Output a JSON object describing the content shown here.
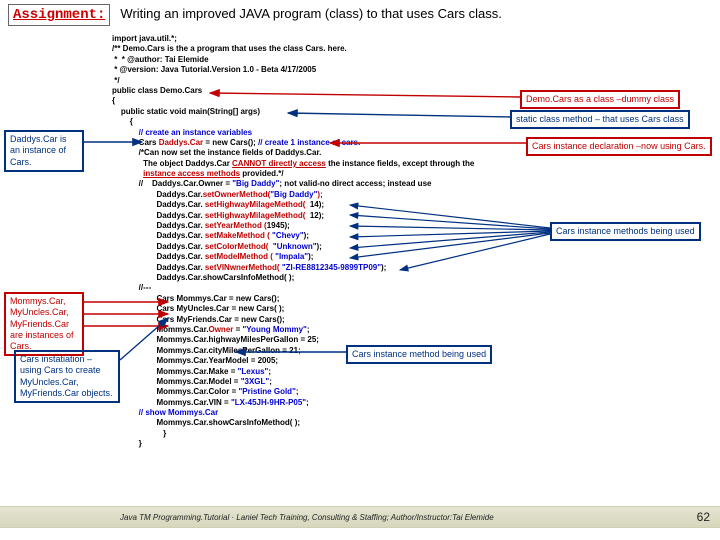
{
  "header": {
    "assignment_label": "Assignment:",
    "assignment_text": "Writing an improved JAVA program (class) to that uses Cars class."
  },
  "code": {
    "l1": "import java.util.*;",
    "l2": "/** Demo.Cars is the a program that uses the class Cars. here.",
    "l3": " *  * @author: Tai Elemide",
    "l4": " * @version: Java Tutorial.Version 1.0 - Beta 4/17/2005",
    "l5": " */",
    "l6": "public class Demo.Cars",
    "l7": "{",
    "l8": "    public static void main(String[] args)",
    "l9": "        {",
    "l10a": "            ",
    "l10b": "// create an instance variables",
    "l11a": "            Cars ",
    "l11b": "Daddys.Car",
    "l11c": " = new Cars(); ",
    "l11d": "// create 1 instance of cars.",
    "blank1": "",
    "c1a": "            /*Can now set the instance fields of Daddys.Car.",
    "c1b": "              The object Daddys.Car ",
    "c1c": "CANNOT directly access",
    "c1d": " the instance fields, except through the",
    "c2a": "              ",
    "c2b": "instance access methods",
    "c2c": " provided.*/",
    "c3a": "            //    Daddys.Car.Owner = ",
    "c3b": "\"Big Daddy\"",
    "c3c": "; not valid-no direct access; instead use",
    "m1a": "                    Daddys.Car.",
    "m1b": "setOwnerMethod(",
    "m1c": "\"Big Daddy\"",
    "m1d": ");",
    "m2a": "                    Daddys.Car. ",
    "m2b": "setHighwayMilageMethod(",
    "m2c": "  14);",
    "m3a": "                    Daddys.Car. ",
    "m3b": "setHighwayMilageMethod(",
    "m3c": "  12);",
    "m4a": "                    Daddys.Car. ",
    "m4b": "setYearMethod (",
    "m4c": "1945);",
    "m5a": "                    Daddys.Car. ",
    "m5b": "setMakeMethod (",
    "m5c": " \"Chevy\"",
    "m5d": ");",
    "m6a": "                    Daddys.Car. ",
    "m6b": "setColorMethod(",
    "m6c": "  \"Unknown\"",
    "m6d": ");",
    "m7a": "                    Daddys.Car. ",
    "m7b": "setModelMethod (",
    "m7c": " \"Impala\"",
    "m7d": ");",
    "m8a": "                    Daddys.Car. ",
    "m8b": "setVINwnerMethod(",
    "m8c": " \"ZI-RE8812345-9899TP09\"",
    "m8d": ");",
    "m9": "                    Daddys.Car.showCarsInfoMethod( );",
    "dash": "            //---",
    "i1": "                    Cars Mommys.Car = new Cars();",
    "i2": "                    Cars MyUncles.Car = new Cars( );",
    "i3": "                    Cars MyFriends.Car = new Cars();",
    "blank2": "",
    "s1a": "                    Mommys.Car.",
    "s1b": "Owner",
    "s1c": " = ",
    "s1d": "\"Young Mommy\"",
    "s1e": ";",
    "s2": "                    Mommys.Car.highwayMilesPerGallon = 25;",
    "s3": "                    Mommys.Car.cityMilesPerGallon = 21;",
    "s4": "                    Mommys.Car.YearModel = 2005;",
    "s5a": "                    Mommys.Car.Make = ",
    "s5b": "\"Lexus\"",
    "s5c": ";",
    "s6a": "                    Mommys.Car.Model = ",
    "s6b": "\"3XGL\"",
    "s6c": ";",
    "s7a": "                    Mommys.Car.Color = ",
    "s7b": "\"Pristine Gold\"",
    "s7c": ";",
    "s8a": "                    Mommys.Car.VIN = ",
    "s8b": "\"LX-45JH-9HR-P05\"",
    "s8c": ";",
    "f1": "            // show Mommys.Car",
    "f2": "                    Mommys.Car.showCarsInfoMethod( );",
    "f3": "                       }",
    "f4": "            }"
  },
  "callouts": {
    "c_daddys": "Daddys.Car is an\ninstance of Cars.",
    "c_instances": "Mommys.Car,\nMyUncles.Car,\nMyFriends.Car\nare instances of\nCars.",
    "c_instatiation": "Cars instatiation –\nusing Cars to create\nMyUncles.Car,\nMyFriends.Car objects.",
    "c_dummy": "Demo.Cars as a class –dummy class",
    "c_static": "static class method – that uses Cars class",
    "c_decl": "Cars instance declaration –now using Cars.",
    "c_methods": "Cars instance methods being used",
    "c_method_single": "Cars instance method being used"
  },
  "footer": {
    "text": "Java TM Programming.Tutorial · Laniel Tech Training, Consulting & Staffing; Author/Instructor:Tai Elemide",
    "page": "62"
  }
}
